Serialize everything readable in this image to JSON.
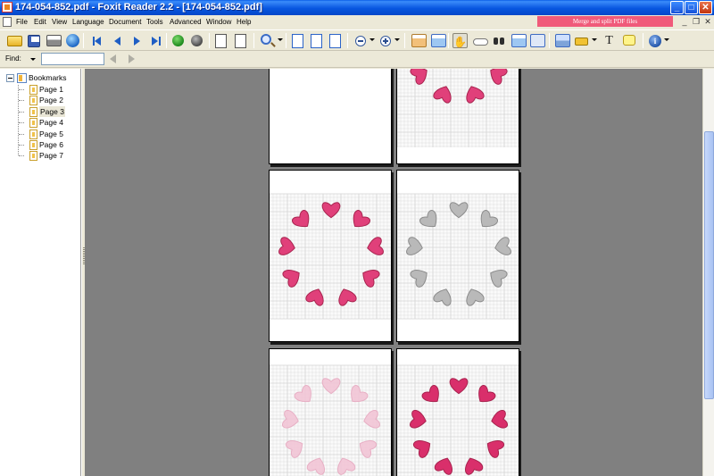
{
  "window": {
    "title": "174-054-852.pdf - Foxit Reader 2.2 - [174-054-852.pdf]",
    "minimize_label": "_",
    "maximize_label": "□",
    "close_label": "✕"
  },
  "menu": {
    "items": [
      "File",
      "Edit",
      "View",
      "Language",
      "Document",
      "Tools",
      "Advanced",
      "Window",
      "Help"
    ],
    "banner_text": "Merge and split PDF files",
    "mdi_minimize": "_",
    "mdi_restore": "❐",
    "mdi_close": "✕"
  },
  "toolbar": {
    "icons": [
      "open-icon",
      "save-icon",
      "print-icon",
      "web-icon",
      "first-page-icon",
      "previous-page-icon",
      "next-page-icon",
      "last-page-icon",
      "go-back-icon",
      "go-forward-icon",
      "rotate-left-icon",
      "rotate-right-icon",
      "zoom-icon",
      "actual-size-icon",
      "fit-page-icon",
      "fit-width-icon",
      "zoom-out-icon",
      "zoom-in-icon",
      "single-page-icon",
      "continuous-icon",
      "hand-tool-icon",
      "select-text-icon",
      "find-icon",
      "typewriter-icon",
      "snapshot-icon",
      "highlight-icon",
      "pen-icon",
      "text-tool-icon",
      "note-icon",
      "info-icon"
    ],
    "text_tool_glyph": "T",
    "info_glyph": "i"
  },
  "findbar": {
    "label": "Find:",
    "value": "",
    "placeholder": ""
  },
  "bookmarks": {
    "root_label": "Bookmarks",
    "items": [
      "Page 1",
      "Page 2",
      "Page 3",
      "Page 4",
      "Page 5",
      "Page 6",
      "Page 7"
    ],
    "selected_index": 2
  },
  "document": {
    "page_style": {
      "colors": {
        "pink": "#e0407a",
        "dark_pink": "#a8244f",
        "gray": "#b9b9b9",
        "light_pink": "#f2c5d6",
        "grid": "#d3d3d3"
      }
    }
  },
  "scrollbar": {
    "position_fraction": 0.3
  }
}
